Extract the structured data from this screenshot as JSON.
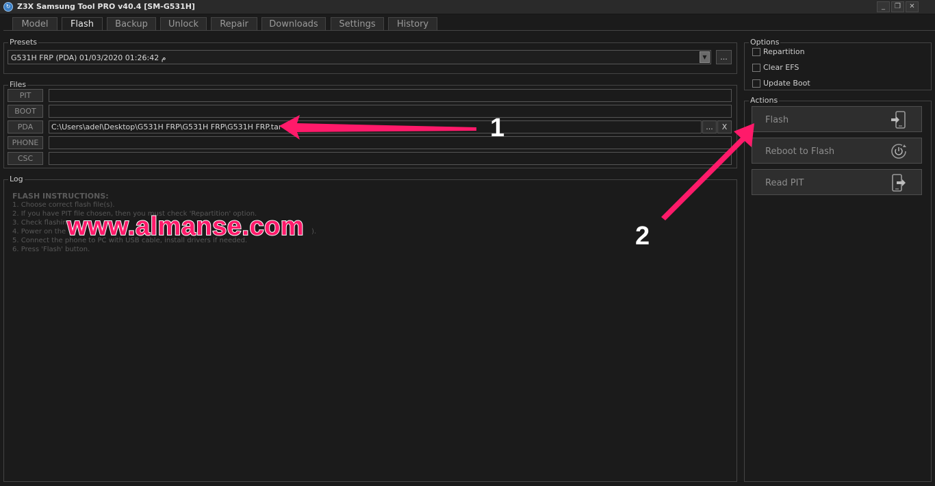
{
  "window": {
    "title": "Z3X Samsung Tool PRO v40.4 [SM-G531H]",
    "icon": "z3x-app-icon",
    "controls": {
      "minimize": "_",
      "restore": "❐",
      "close": "✕"
    }
  },
  "tabs": [
    {
      "label": "Model"
    },
    {
      "label": "Flash",
      "active": true
    },
    {
      "label": "Backup"
    },
    {
      "label": "Unlock"
    },
    {
      "label": "Repair"
    },
    {
      "label": "Downloads"
    },
    {
      "label": "Settings"
    },
    {
      "label": "History"
    }
  ],
  "presets": {
    "label": "Presets",
    "selected": "G531H FRP (PDA) 01/03/2020 01:26:42 م",
    "browse_label": "..."
  },
  "files": {
    "label": "Files",
    "rows": [
      {
        "label": "PIT",
        "value": ""
      },
      {
        "label": "BOOT",
        "value": ""
      },
      {
        "label": "PDA",
        "value": "C:\\Users\\adel\\Desktop\\G531H FRP\\G531H FRP\\G531H FRP.tar",
        "browse_label": "...",
        "clear_label": "X"
      },
      {
        "label": "PHONE",
        "value": ""
      },
      {
        "label": "CSC",
        "value": ""
      }
    ]
  },
  "log": {
    "label": "Log",
    "title": "FLASH INSTRUCTIONS:",
    "lines": [
      "1. Choose correct flash file(s).",
      "2. If you have PIT file chosen, then you must check 'Repartition' option.",
      "3. Check flashing",
      "4. Power on the",
      "5. Connect the phone to PC with USB cable, install drivers if needed.",
      "6. Press 'Flash' button."
    ],
    "line4_tail": ")."
  },
  "options": {
    "label": "Options",
    "items": [
      {
        "label": "Repartition",
        "checked": false
      },
      {
        "label": "Clear EFS",
        "checked": false
      },
      {
        "label": "Update Boot",
        "checked": false
      }
    ]
  },
  "actions": {
    "label": "Actions",
    "buttons": [
      {
        "label": "Flash",
        "icon": "phone-arrow-in-icon"
      },
      {
        "label": "Reboot to Flash",
        "icon": "power-cycle-icon"
      },
      {
        "label": "Read PIT",
        "icon": "phone-arrow-out-icon"
      }
    ]
  },
  "annotations": {
    "watermark": "www.almanse.com",
    "marker_1": "1",
    "marker_2": "2",
    "arrow_color": "#ff1a6a"
  }
}
